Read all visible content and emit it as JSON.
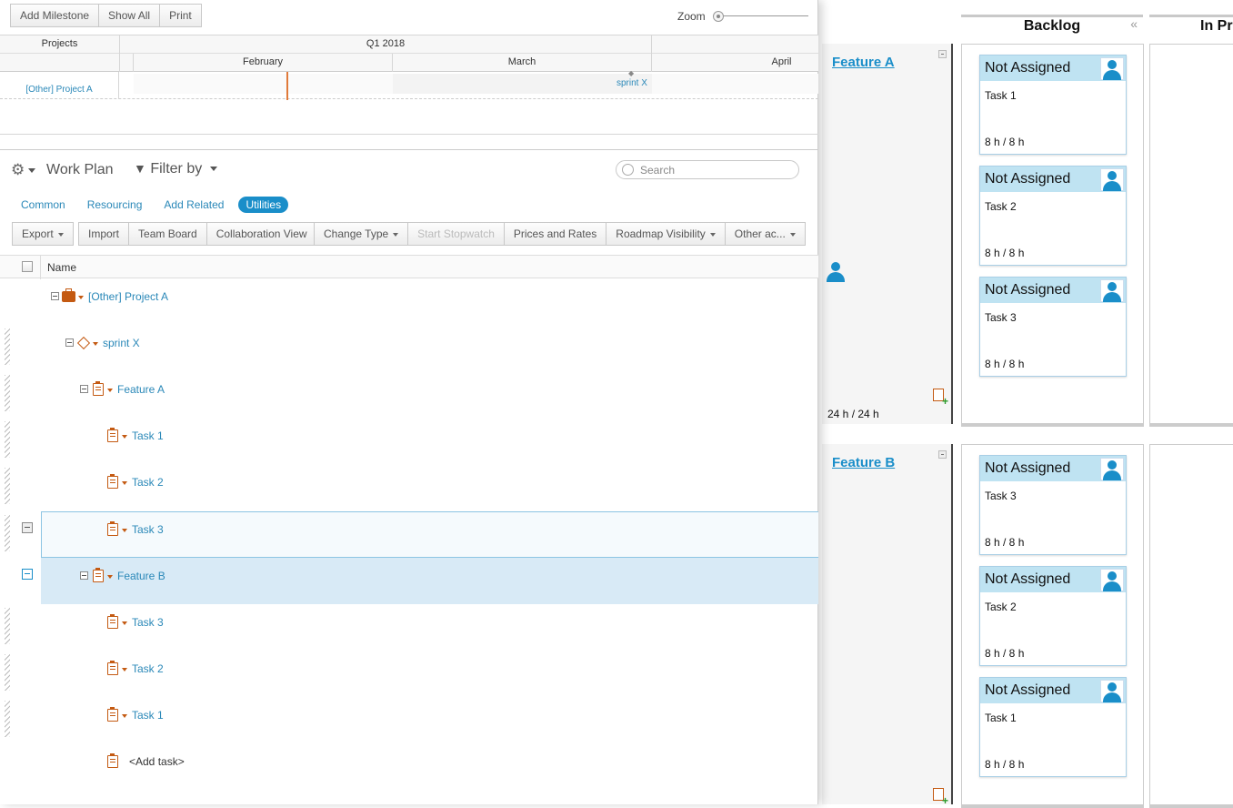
{
  "timeline": {
    "toolbar": {
      "add_milestone": "Add Milestone",
      "show_all": "Show All",
      "print": "Print",
      "zoom_label": "Zoom"
    },
    "projects_header": "Projects",
    "quarter": "Q1 2018",
    "months": [
      "February",
      "March",
      "April"
    ],
    "project_row": "[Other] Project A",
    "sprint_label": "sprint X"
  },
  "workplan": {
    "title": "Work Plan",
    "filter_label": "Filter by",
    "search_placeholder": "Search",
    "tabs": [
      {
        "label": "Common"
      },
      {
        "label": "Resourcing"
      },
      {
        "label": "Add Related"
      },
      {
        "label": "Utilities"
      }
    ],
    "active_tab": "Utilities",
    "toolbar": {
      "export": "Export",
      "import": "Import",
      "team_board": "Team Board",
      "collaboration_view": "Collaboration View",
      "change_type": "Change Type",
      "start_stopwatch": "Start Stopwatch",
      "prices_and_rates": "Prices and Rates",
      "roadmap_visibility": "Roadmap Visibility",
      "other_actions": "Other ac..."
    },
    "name_column": "Name",
    "rows": [
      {
        "label": "[Other] Project A",
        "type": "project"
      },
      {
        "label": "sprint X",
        "type": "sprint"
      },
      {
        "label": "Feature A",
        "type": "feature"
      },
      {
        "label": "Task 1",
        "type": "task"
      },
      {
        "label": "Task 2",
        "type": "task"
      },
      {
        "label": "Task 3",
        "type": "task"
      },
      {
        "label": "Feature B",
        "type": "feature"
      },
      {
        "label": "Task 3",
        "type": "task"
      },
      {
        "label": "Task 2",
        "type": "task"
      },
      {
        "label": "Task 1",
        "type": "task"
      },
      {
        "label": "<Add task>",
        "type": "add"
      }
    ]
  },
  "board": {
    "columns": [
      {
        "title": "Backlog"
      },
      {
        "title": "In Pr"
      }
    ],
    "lanes": [
      {
        "title": "Feature A",
        "total": "24 h / 24 h",
        "cards": [
          {
            "assignee": "Not Assigned",
            "name": "Task 1",
            "estimate": "8 h / 8 h"
          },
          {
            "assignee": "Not Assigned",
            "name": "Task 2",
            "estimate": "8 h / 8 h"
          },
          {
            "assignee": "Not Assigned",
            "name": "Task 3",
            "estimate": "8 h / 8 h"
          }
        ]
      },
      {
        "title": "Feature B",
        "cards": [
          {
            "assignee": "Not Assigned",
            "name": "Task 3",
            "estimate": "8 h / 8 h"
          },
          {
            "assignee": "Not Assigned",
            "name": "Task 2",
            "estimate": "8 h / 8 h"
          },
          {
            "assignee": "Not Assigned",
            "name": "Task 1",
            "estimate": "8 h / 8 h"
          }
        ]
      }
    ]
  },
  "colors": {
    "accent": "#1a8ec9",
    "link": "#2a88b8",
    "task_icon": "#c45a12",
    "card_header": "#bfe3f2",
    "today_line": "#e07a3a"
  }
}
